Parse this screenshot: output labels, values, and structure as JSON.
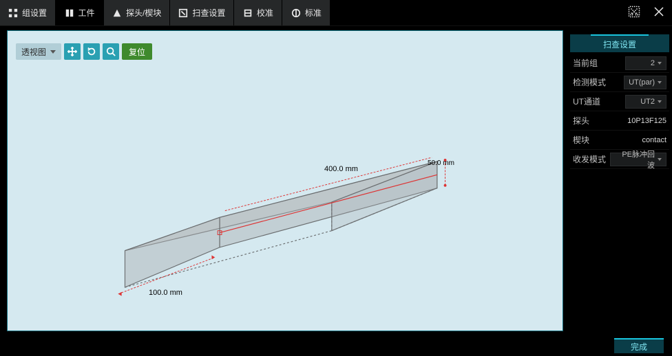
{
  "tabs": [
    {
      "label": "组设置",
      "icon": "settings-grid-icon"
    },
    {
      "label": "工件",
      "icon": "workpiece-icon"
    },
    {
      "label": "探头/楔块",
      "icon": "probe-icon"
    },
    {
      "label": "扫查设置",
      "icon": "scan-settings-icon"
    },
    {
      "label": "校准",
      "icon": "calibrate-icon"
    },
    {
      "label": "标准",
      "icon": "standard-icon"
    }
  ],
  "active_tab_index": 1,
  "viewport": {
    "view_mode": "透视图",
    "reset_label": "复位",
    "tools": {
      "move": "move-icon",
      "rotate": "rotate-icon",
      "zoom": "zoom-icon"
    },
    "dimensions": {
      "width": "100.0 mm",
      "length": "400.0 mm",
      "height": "50.0 mm"
    }
  },
  "right_panel": {
    "title": "扫查设置",
    "rows": [
      {
        "label": "当前组",
        "value": "2",
        "kind": "select"
      },
      {
        "label": "检测模式",
        "value": "UT(par)",
        "kind": "select"
      },
      {
        "label": "UT通道",
        "value": "UT2",
        "kind": "select"
      },
      {
        "label": "探头",
        "value": "10P13F125",
        "kind": "text"
      },
      {
        "label": "楔块",
        "value": "contact",
        "kind": "text"
      },
      {
        "label": "收发模式",
        "value": "PE脉冲回波",
        "kind": "select"
      }
    ]
  },
  "footer": {
    "done_label": "完成"
  }
}
